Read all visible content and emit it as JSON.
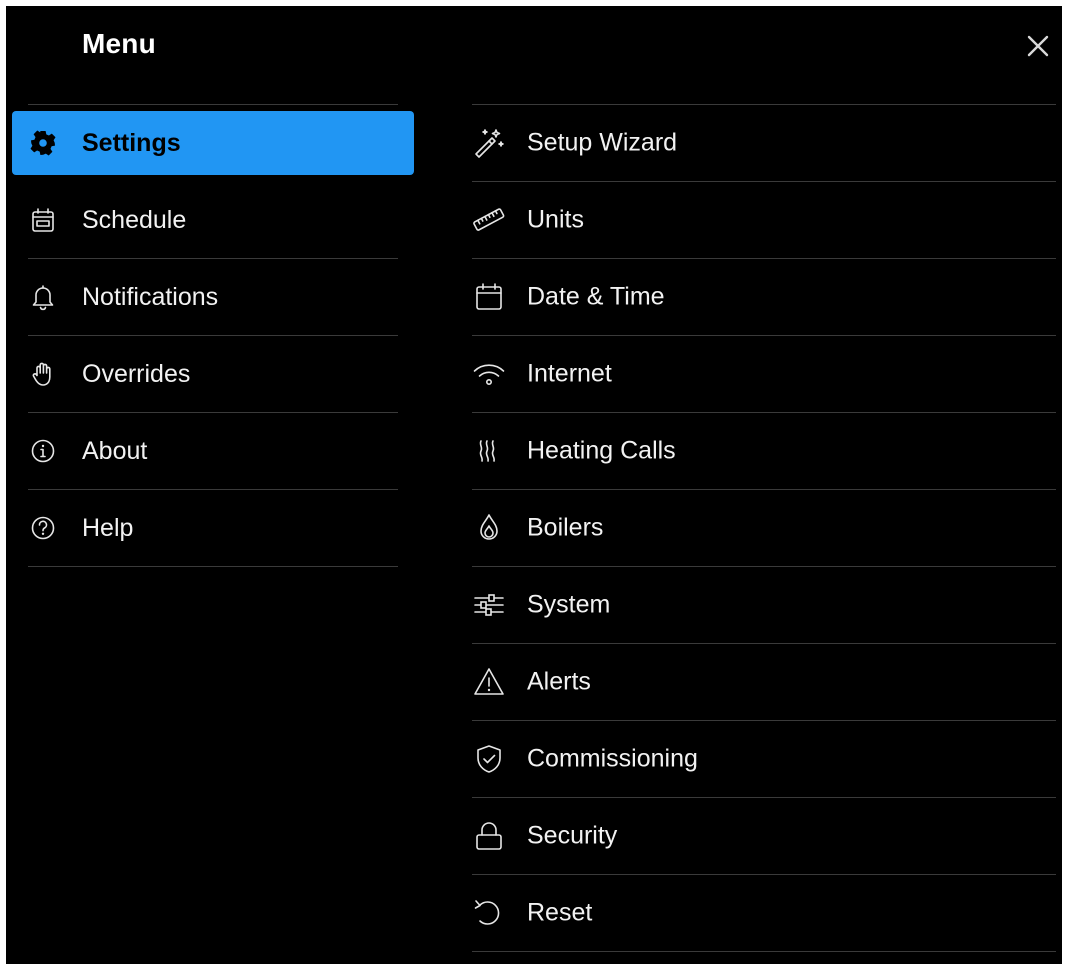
{
  "header": {
    "title": "Menu",
    "close_icon": "close-icon"
  },
  "colors": {
    "background": "#000000",
    "accent": "#2196f3",
    "divider": "#3a3a3a",
    "text": "#f2f2f2"
  },
  "left_menu": {
    "selected": "Settings",
    "items": [
      {
        "label": "Settings",
        "icon": "gear-icon",
        "active": true
      },
      {
        "label": "Schedule",
        "icon": "calendar-schedule-icon",
        "active": false
      },
      {
        "label": "Notifications",
        "icon": "bell-icon",
        "active": false
      },
      {
        "label": "Overrides",
        "icon": "hand-icon",
        "active": false
      },
      {
        "label": "About",
        "icon": "info-icon",
        "active": false
      },
      {
        "label": "Help",
        "icon": "help-icon",
        "active": false
      }
    ]
  },
  "settings_menu": {
    "items": [
      {
        "label": "Setup Wizard",
        "icon": "magic-wand-icon"
      },
      {
        "label": "Units",
        "icon": "ruler-icon"
      },
      {
        "label": "Date & Time",
        "icon": "calendar-icon"
      },
      {
        "label": "Internet",
        "icon": "wifi-icon"
      },
      {
        "label": "Heating Calls",
        "icon": "heat-waves-icon"
      },
      {
        "label": "Boilers",
        "icon": "flame-icon"
      },
      {
        "label": "System",
        "icon": "sliders-icon"
      },
      {
        "label": "Alerts",
        "icon": "warning-icon"
      },
      {
        "label": "Commissioning",
        "icon": "shield-check-icon"
      },
      {
        "label": "Security",
        "icon": "lock-icon"
      },
      {
        "label": "Reset",
        "icon": "reset-icon"
      }
    ]
  }
}
